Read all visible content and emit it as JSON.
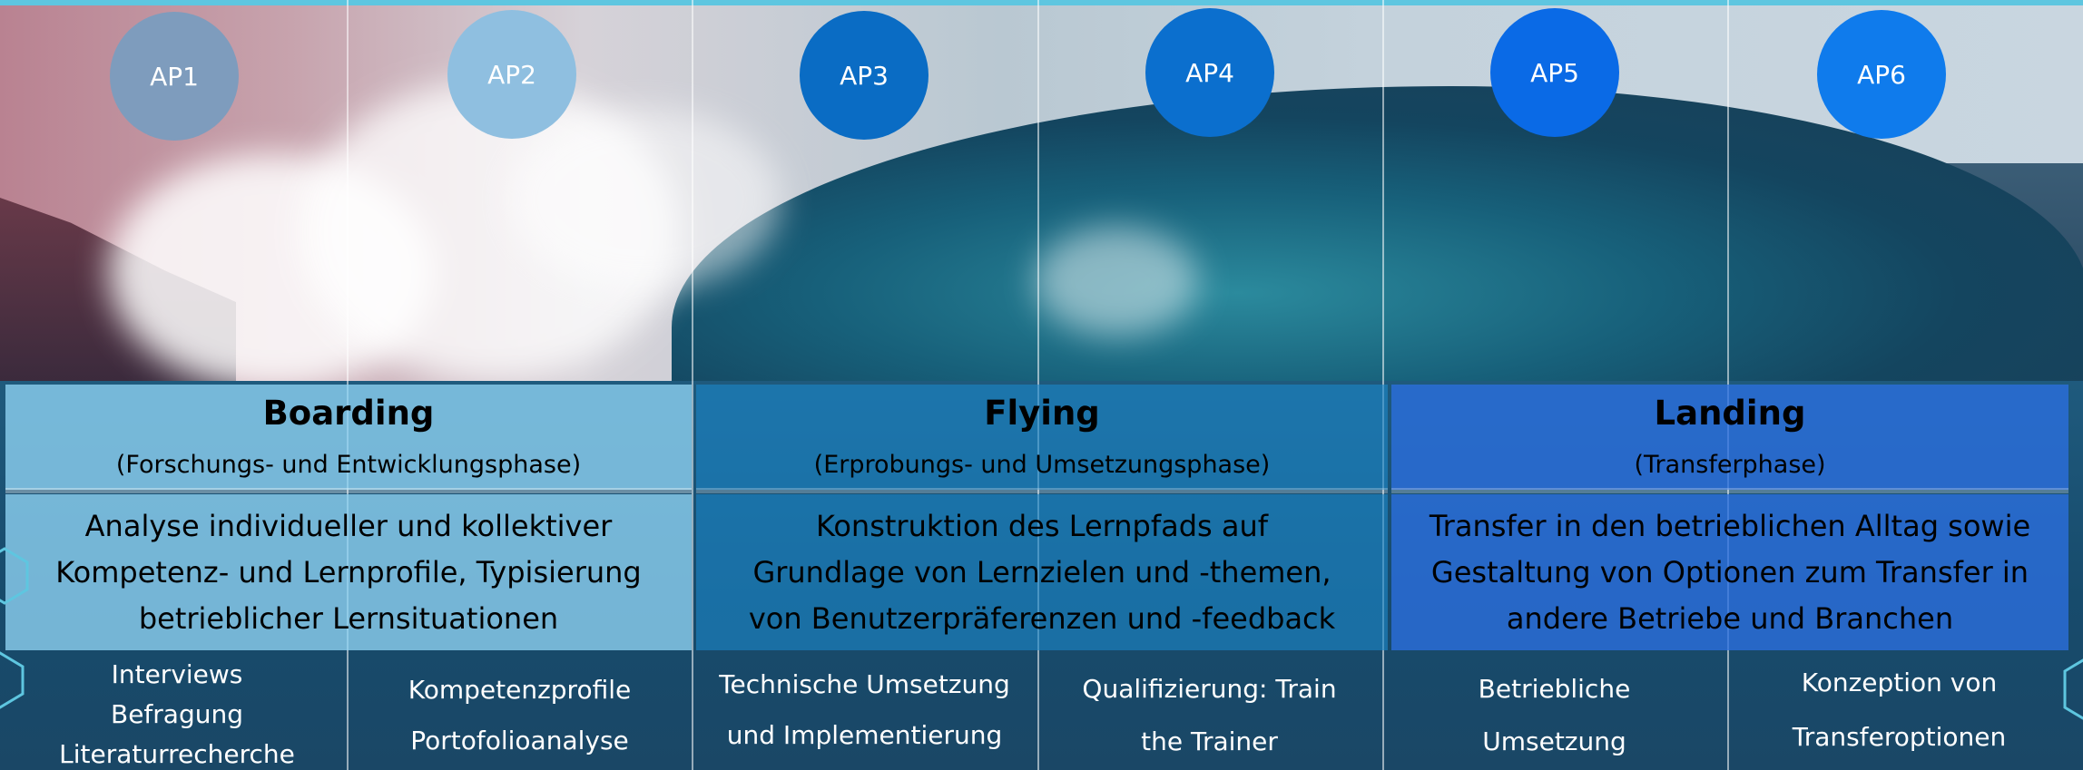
{
  "work_packages": [
    {
      "label": "AP1",
      "color": "#7e9cbd"
    },
    {
      "label": "AP2",
      "color": "#8fbfe0"
    },
    {
      "label": "AP3",
      "color": "#0a6cc4"
    },
    {
      "label": "AP4",
      "color": "#0b6fce"
    },
    {
      "label": "AP5",
      "color": "#0a6ae6"
    },
    {
      "label": "AP6",
      "color": "#0f7bec"
    }
  ],
  "phases": [
    {
      "title": "Boarding",
      "subtitle": "(Forschungs- und Entwicklungsphase)",
      "description_lines": [
        "Analyse individueller und kollektiver",
        "Kompetenz- und Lernprofile, Typisierung",
        "betrieblicher Lernsituationen"
      ],
      "color": "#8fd3f4"
    },
    {
      "title": "Flying",
      "subtitle": "(Erprobungs- und Umsetzungsphase)",
      "description_lines": [
        "Konstruktion des Lernpfads auf",
        "Grundlage von Lernzielen und -themen,",
        "von Benutzerpräferenzen und -feedback"
      ],
      "color": "#1b86c8"
    },
    {
      "title": "Landing",
      "subtitle": "(Transferphase)",
      "description_lines": [
        "Transfer in den betrieblichen Alltag sowie",
        "Gestaltung von Optionen zum Transfer in",
        "andere Betriebe und Branchen"
      ],
      "color": "#2b6fe0"
    }
  ],
  "tasks": [
    {
      "lines": [
        "Interviews",
        "Befragung",
        "Literaturrecherche"
      ]
    },
    {
      "lines": [
        "Kompetenzprofile",
        "Portofolioanalyse"
      ]
    },
    {
      "lines": [
        "Technische Umsetzung",
        "und Implementierung"
      ]
    },
    {
      "lines": [
        "Qualifizierung: Train",
        "the Trainer"
      ]
    },
    {
      "lines": [
        "Betriebliche",
        "Umsetzung"
      ]
    },
    {
      "lines": [
        "Konzeption von",
        "Transferoptionen"
      ]
    }
  ]
}
